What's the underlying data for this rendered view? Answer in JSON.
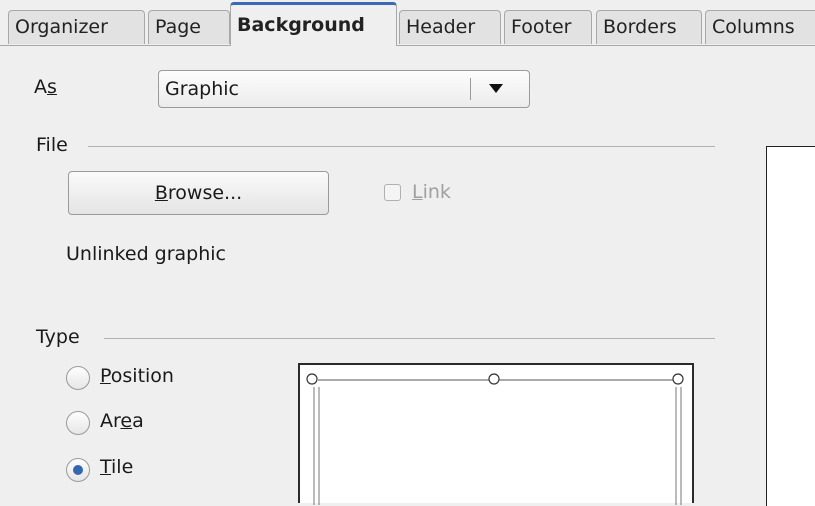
{
  "tabs": [
    {
      "label": "Organizer",
      "active": false
    },
    {
      "label": "Page",
      "active": false
    },
    {
      "label": "Background",
      "active": true
    },
    {
      "label": "Header",
      "active": false
    },
    {
      "label": "Footer",
      "active": false
    },
    {
      "label": "Borders",
      "active": false
    },
    {
      "label": "Columns",
      "active": false
    }
  ],
  "as": {
    "label_pre": "A",
    "label_mnemonic": "s",
    "value": "Graphic"
  },
  "file": {
    "section_label": "File",
    "browse_mnemonic": "B",
    "browse_rest": "rowse...",
    "link_mnemonic": "L",
    "link_rest": "ink",
    "status": "Unlinked graphic"
  },
  "type": {
    "section_label": "Type",
    "options": [
      {
        "pre": "",
        "mnemonic": "P",
        "post": "osition",
        "checked": false
      },
      {
        "pre": "Ar",
        "mnemonic": "e",
        "post": "a",
        "checked": false
      },
      {
        "pre": "",
        "mnemonic": "T",
        "post": "ile",
        "checked": true
      }
    ]
  },
  "colors": {
    "accent": "#3a6ab5",
    "radio_dot": "#3567b0"
  }
}
